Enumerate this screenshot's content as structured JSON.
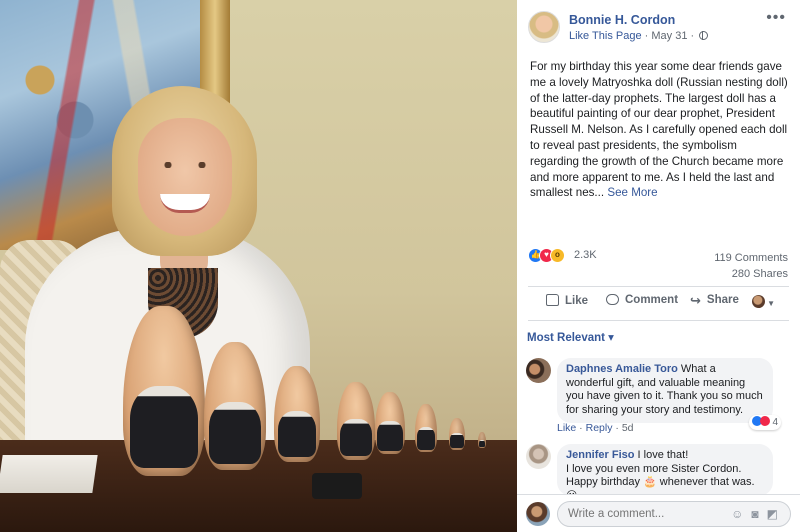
{
  "post": {
    "author": "Bonnie H. Cordon",
    "like_page": "Like This Page",
    "separator": " · ",
    "date": "May 31",
    "date_sep": " · ",
    "text": "For my birthday this year some dear friends gave me a lovely Matryoshka doll (Russian nesting doll) of the latter-day prophets. The largest doll has a beautiful painting of our dear prophet, President Russell M. Nelson. As I carefully opened each doll to reveal past presidents, the symbolism regarding the growth of the Church became more and more apparent to me. As I held the last and smallest nes...",
    "see_more": "See More",
    "more_menu": "•••",
    "privacy_icon": "globe-icon"
  },
  "stats": {
    "reaction_count": "2.3K",
    "comments": "119 Comments",
    "shares": "280 Shares",
    "reaction_types": [
      "like",
      "love",
      "wow"
    ]
  },
  "actions": {
    "like": "Like",
    "comment": "Comment",
    "share": "Share"
  },
  "sort": {
    "label": "Most Relevant",
    "caret": "▾"
  },
  "comments": [
    {
      "author": "Daphnes Amalie Toro",
      "text": "What a wonderful gift, and valuable meaning you have given to it. Thank you so much for sharing your story and testimony.",
      "reactions": "4",
      "like": "Like",
      "reply": "Reply",
      "time": "5d",
      "sep": " · "
    },
    {
      "author": "Jennifer Fiso",
      "text_line1": "I love that!",
      "text_line2": "I love you even more Sister Cordon.",
      "text_line3": "Happy birthday 🎂 whenever that was.😀"
    }
  ],
  "composer": {
    "placeholder": "Write a comment..."
  },
  "colors": {
    "link": "#365899",
    "like_reaction": "#2078f4",
    "love_reaction": "#f0284a",
    "wow_reaction": "#f7b928"
  }
}
